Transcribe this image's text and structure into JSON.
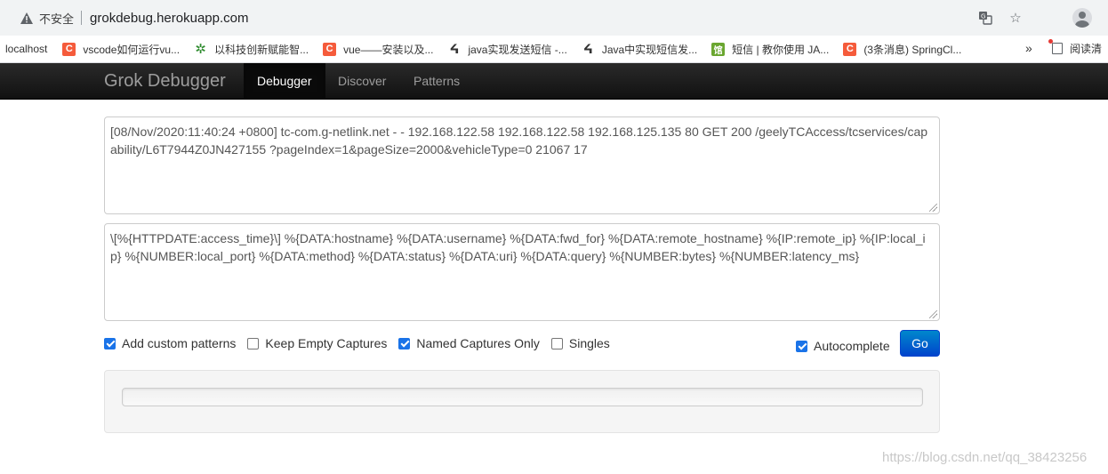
{
  "browser": {
    "insecure_label": "不安全",
    "url": "grokdebug.herokuapp.com"
  },
  "bookmarks": {
    "items": [
      {
        "label": "localhost",
        "icon": "none"
      },
      {
        "label": "vscode如何运行vu...",
        "icon": "csdn-c-icon"
      },
      {
        "label": "以科技创新赋能智...",
        "icon": "green-gear-icon"
      },
      {
        "label": "vue——安装以及...",
        "icon": "csdn-c-icon"
      },
      {
        "label": "java实现发送短信 -...",
        "icon": "tent-icon"
      },
      {
        "label": "Java中实现短信发...",
        "icon": "tent-icon"
      },
      {
        "label": "短信 | 教你使用 JA...",
        "icon": "green-square-icon"
      },
      {
        "label": "(3条消息) SpringCl...",
        "icon": "csdn-c-icon"
      }
    ],
    "more": "»",
    "reading_list": "阅读清"
  },
  "navbar": {
    "brand": "Grok Debugger",
    "items": [
      "Debugger",
      "Discover",
      "Patterns"
    ],
    "active": "Debugger"
  },
  "form": {
    "input_text": "[08/Nov/2020:11:40:24 +0800] tc-com.g-netlink.net - - 192.168.122.58 192.168.122.58 192.168.125.135 80 GET 200 /geelyTCAccess/tcservices/capability/L6T7944Z0JN427155 ?pageIndex=1&pageSize=2000&vehicleType=0 21067 17",
    "pattern_text": "\\[%{HTTPDATE:access_time}\\] %{DATA:hostname} %{DATA:username} %{DATA:fwd_for} %{DATA:remote_hostname} %{IP:remote_ip} %{IP:local_ip} %{NUMBER:local_port} %{DATA:method} %{DATA:status} %{DATA:uri} %{DATA:query} %{NUMBER:bytes} %{NUMBER:latency_ms}",
    "options": [
      {
        "label": "Add custom patterns",
        "checked": true
      },
      {
        "label": "Keep Empty Captures",
        "checked": false
      },
      {
        "label": "Named Captures Only",
        "checked": true
      },
      {
        "label": "Singles",
        "checked": false
      }
    ],
    "autocomplete": {
      "label": "Autocomplete",
      "checked": true
    },
    "go_label": "Go",
    "accent_color": "#0044cc"
  },
  "watermark": "https://blog.csdn.net/qq_38423256"
}
